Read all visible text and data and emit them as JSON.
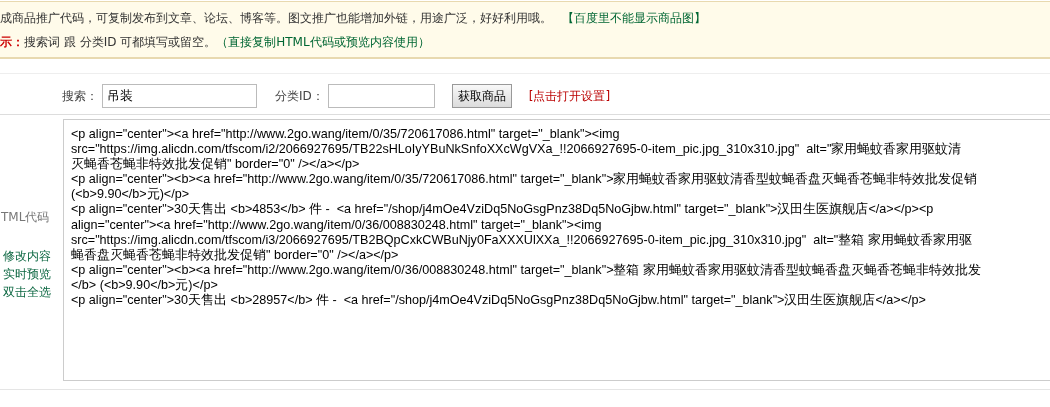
{
  "notice": {
    "line1": "成商品推广代码，可复制发布到文章、论坛、博客等。图文推广也能增加外链，用途广泛，好好利用哦。",
    "line1_note": "【百度里不能显示商品图】",
    "tip_label": "示：",
    "tip_text": "搜索词 跟 分类ID 可都填写或留空。",
    "tip_note": "（直接复制HTML代码或预览内容使用）"
  },
  "form": {
    "search_label": "搜索：",
    "search_value": "吊装",
    "category_label": "分类ID：",
    "fetch_button": "获取商品",
    "settings_link": "[点击打开设置]"
  },
  "code_panel": {
    "label": "TML代码",
    "actions": [
      "修改内容",
      "实时预览",
      "双击全选"
    ],
    "lines": [
      "<p align=\"center\"><a href=\"http://www.2go.wang/item/0/35/720617086.html\" target=\"_blank\"><img",
      "src=\"https://img.alicdn.com/tfscom/i2/2066927695/TB22sHLoIyYBuNkSnfoXXcWgVXa_!!2066927695-0-item_pic.jpg_310x310.jpg\"  alt=\"家用蝇蚊香家用驱蚊清",
      "灭蝇香苍蝇非特效批发促销\" border=\"0\" /></a></p>",
      "<p align=\"center\"><b><a href=\"http://www.2go.wang/item/0/35/720617086.html\" target=\"_blank\">家用蝇蚊香家用驱蚊清香型蚊蝇香盘灭蝇香苍蝇非特效批发促销",
      "(<b>9.90</b>元)</p>",
      "<p align=\"center\">30天售出 <b>4853</b> 件 -  <a href=\"/shop/j4mOe4VziDq5NoGsgPnz38Dq5NoGjbw.html\" target=\"_blank\">汉田生医旗舰店</a></p><p",
      "align=\"center\"><a href=\"http://www.2go.wang/item/0/36/008830248.html\" target=\"_blank\"><img",
      "src=\"https://img.alicdn.com/tfscom/i3/2066927695/TB2BQpCxkCWBuNjy0FaXXXUlXXa_!!2066927695-0-item_pic.jpg_310x310.jpg\"  alt=\"整箱 家用蝇蚊香家用驱",
      "蝇香盘灭蝇香苍蝇非特效批发促销\" border=\"0\" /></a></p>",
      "<p align=\"center\"><b><a href=\"http://www.2go.wang/item/0/36/008830248.html\" target=\"_blank\">整箱 家用蝇蚊香家用驱蚊清香型蚊蝇香盘灭蝇香苍蝇非特效批发",
      "</b> (<b>9.90</b>元)</p>",
      "<p align=\"center\">30天售出 <b>28957</b> 件 -  <a href=\"/shop/j4mOe4VziDq5NoGsgPnz38Dq5NoGjbw.html\" target=\"_blank\">汉田生医旗舰店</a></p>"
    ]
  }
}
